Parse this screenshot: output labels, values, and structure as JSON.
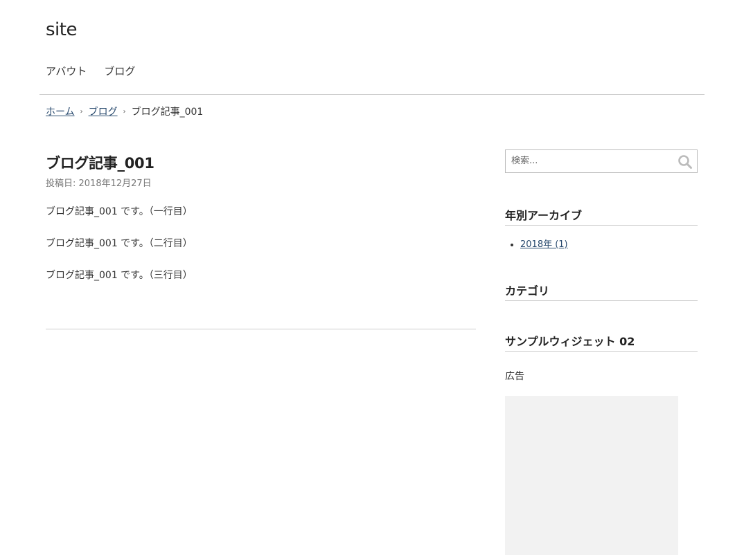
{
  "header": {
    "site_title": "site",
    "nav": [
      {
        "label": "アバウト"
      },
      {
        "label": "ブログ"
      }
    ]
  },
  "breadcrumb": {
    "home": "ホーム",
    "blog": "ブログ",
    "current": "ブログ記事_001",
    "separator": "›"
  },
  "post": {
    "title": "ブログ記事_001",
    "meta": "投稿日: 2018年12月27日",
    "paragraphs": [
      "ブログ記事_001 です。（一行目）",
      "ブログ記事_001 です。（二行目）",
      "ブログ記事_001 です。（三行目）"
    ]
  },
  "sidebar": {
    "search": {
      "placeholder": "検索...",
      "icon": "search-icon"
    },
    "archive": {
      "title": "年別アーカイブ",
      "items": [
        {
          "label": "2018年 (1)"
        }
      ]
    },
    "category": {
      "title": "カテゴリ"
    },
    "sample_widget": {
      "title": "サンプルウィジェット 02",
      "ad_label": "広告"
    }
  },
  "colors": {
    "link": "#2a4b6f",
    "rule": "#cccccc",
    "ad_placeholder": "#f2f2f2"
  }
}
